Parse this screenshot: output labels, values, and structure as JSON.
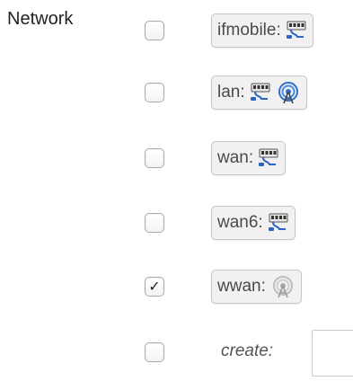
{
  "section_label": "Network",
  "interfaces": [
    {
      "label": "ifmobile:",
      "checked": false,
      "icons": [
        "network-port-icon"
      ]
    },
    {
      "label": "lan:",
      "checked": false,
      "icons": [
        "network-port-icon",
        "wireless-active-icon"
      ]
    },
    {
      "label": "wan:",
      "checked": false,
      "icons": [
        "network-port-icon"
      ]
    },
    {
      "label": "wan6:",
      "checked": false,
      "icons": [
        "network-port-icon"
      ]
    },
    {
      "label": "wwan:",
      "checked": true,
      "icons": [
        "wireless-inactive-icon"
      ]
    }
  ],
  "create": {
    "label": "create:",
    "checked": false,
    "value": ""
  },
  "checkmark": "✓"
}
